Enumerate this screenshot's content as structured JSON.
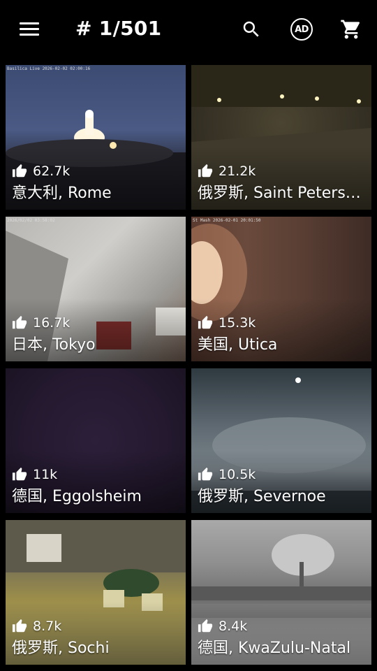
{
  "header": {
    "title": "# 1/501",
    "ad_label": "AD"
  },
  "tiles": [
    {
      "likes": "62.7k",
      "place": "意大利, Rome",
      "stamp": "Basilica Live 2026-02-02 02:00:16"
    },
    {
      "likes": "21.2k",
      "place": "俄罗斯, Saint Petersburg",
      "stamp": ""
    },
    {
      "likes": "16.7k",
      "place": "日本, Tokyo",
      "stamp": "2026/02/02 03:58:02"
    },
    {
      "likes": "15.3k",
      "place": "美国, Utica",
      "stamp": "St Mash 2026-02-01 20:01:50"
    },
    {
      "likes": "11k",
      "place": "德国, Eggolsheim",
      "stamp": ""
    },
    {
      "likes": "10.5k",
      "place": "俄罗斯, Severnoe",
      "stamp": ""
    },
    {
      "likes": "8.7k",
      "place": "俄罗斯, Sochi",
      "stamp": ""
    },
    {
      "likes": "8.4k",
      "place": "德国, KwaZulu-Natal",
      "stamp": ""
    }
  ]
}
